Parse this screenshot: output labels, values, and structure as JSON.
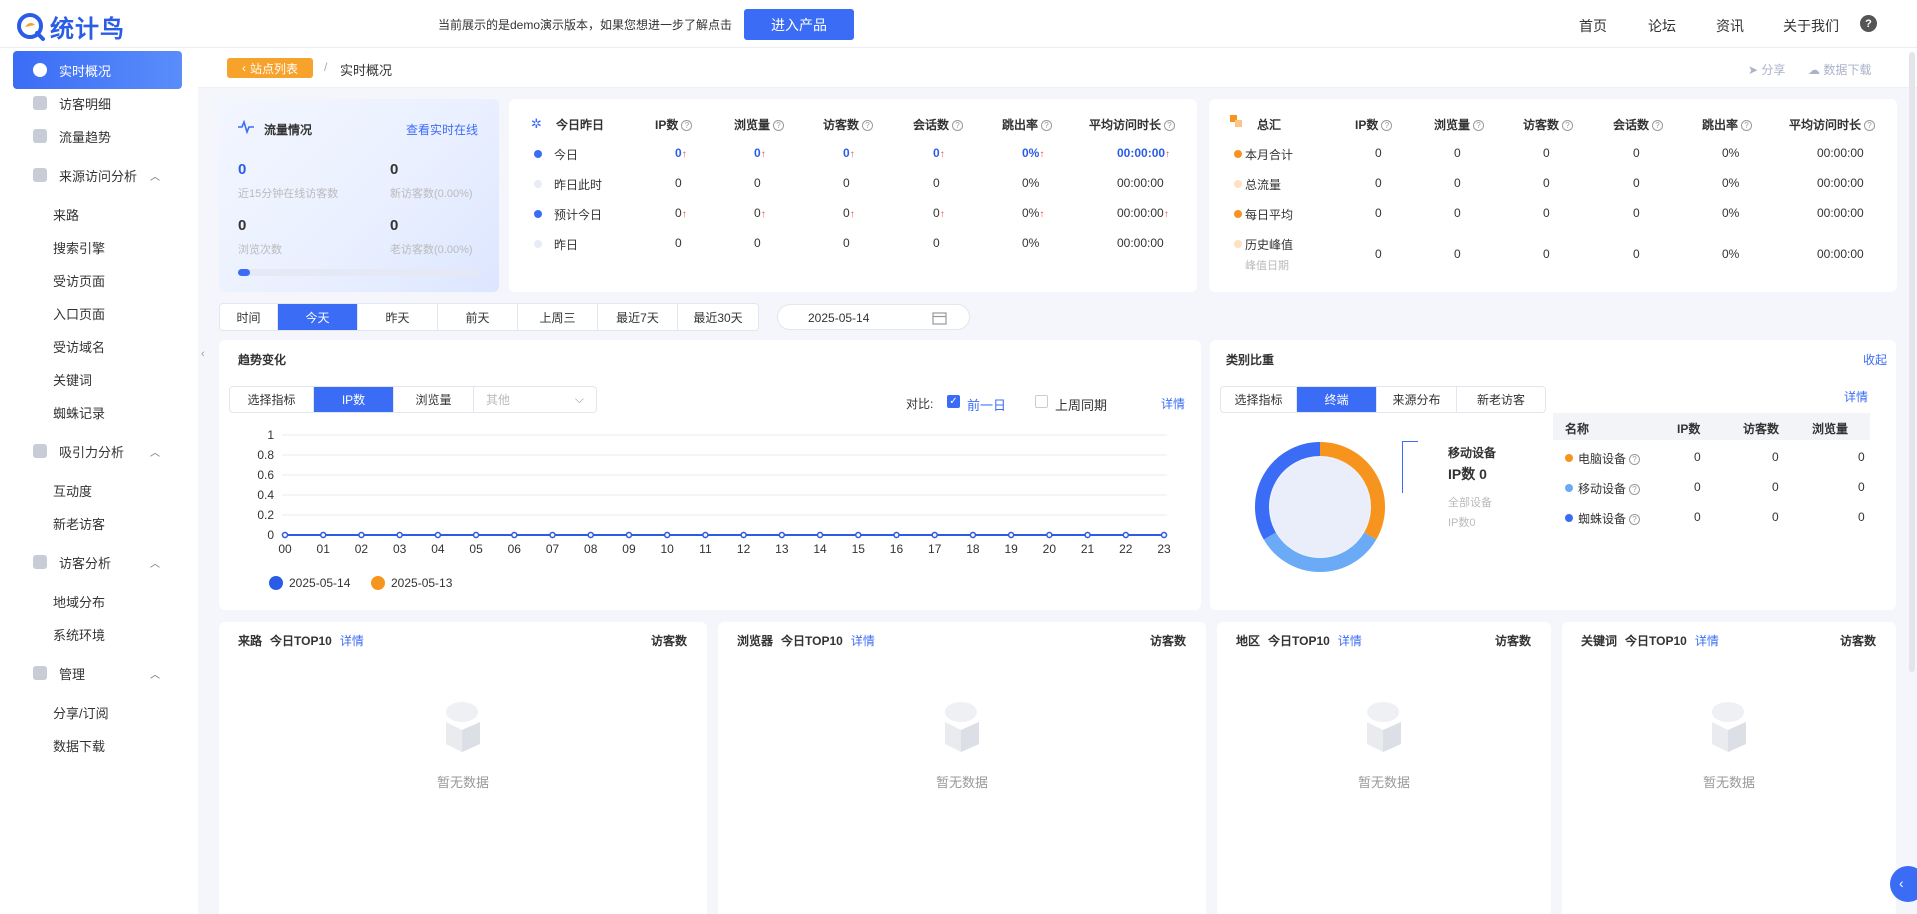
{
  "header": {
    "logo_text": "统计鸟",
    "demo_note": "当前展示的是demo演示版本，如果您想进一步了解点击",
    "enter_button": "进入产品",
    "nav": [
      "首页",
      "论坛",
      "资讯",
      "关于我们"
    ],
    "help": "?"
  },
  "sidebar": {
    "items": [
      {
        "label": "实时概况",
        "type": "top",
        "icon": "clock-icon"
      },
      {
        "label": "访客明细",
        "type": "top",
        "icon": "visitor-detail-icon"
      },
      {
        "label": "流量趋势",
        "type": "top",
        "icon": "trend-icon"
      },
      {
        "label": "来源访问分析",
        "type": "group",
        "icon": "grid-icon"
      },
      {
        "label": "来路",
        "type": "sub"
      },
      {
        "label": "搜索引擎",
        "type": "sub"
      },
      {
        "label": "受访页面",
        "type": "sub"
      },
      {
        "label": "入口页面",
        "type": "sub"
      },
      {
        "label": "受访域名",
        "type": "sub"
      },
      {
        "label": "关键词",
        "type": "sub"
      },
      {
        "label": "蜘蛛记录",
        "type": "sub"
      },
      {
        "label": "吸引力分析",
        "type": "group",
        "icon": "attract-icon"
      },
      {
        "label": "互动度",
        "type": "sub"
      },
      {
        "label": "新老访客",
        "type": "sub"
      },
      {
        "label": "访客分析",
        "type": "group",
        "icon": "user-icon"
      },
      {
        "label": "地域分布",
        "type": "sub"
      },
      {
        "label": "系统环境",
        "type": "sub"
      },
      {
        "label": "管理",
        "type": "group",
        "icon": "manage-icon"
      },
      {
        "label": "分享/订阅",
        "type": "sub"
      },
      {
        "label": "数据下载",
        "type": "sub"
      }
    ]
  },
  "breadcrumb": {
    "back": "站点列表",
    "sep": "/",
    "current": "实时概况",
    "share": "分享",
    "download": "数据下载"
  },
  "flow": {
    "title": "流量情况",
    "link": "查看实时在线",
    "stats": [
      {
        "value": "0",
        "label": "近15分钟在线访客数"
      },
      {
        "value": "0",
        "label": "新访客数(0.00%)"
      },
      {
        "value": "0",
        "label": "浏览次数"
      },
      {
        "value": "0",
        "label": "老访客数(0.00%)"
      }
    ]
  },
  "today": {
    "title": "今日昨日",
    "columns": [
      "IP数",
      "浏览量",
      "访客数",
      "会话数",
      "跳出率",
      "平均访问时长"
    ],
    "rows": [
      {
        "label": "今日",
        "values": [
          "0",
          "0",
          "0",
          "0",
          "0%",
          "00:00:00"
        ],
        "trend": true,
        "dot": "#3b6cf6"
      },
      {
        "label": "昨日此时",
        "values": [
          "0",
          "0",
          "0",
          "0",
          "0%",
          "00:00:00"
        ],
        "trend": false,
        "dot": "#e8ecf7"
      },
      {
        "label": "预计今日",
        "values": [
          "0",
          "0",
          "0",
          "0",
          "0%",
          "00:00:00"
        ],
        "trend": true,
        "dot": "#3b6cf6"
      },
      {
        "label": "昨日",
        "values": [
          "0",
          "0",
          "0",
          "0",
          "0%",
          "00:00:00"
        ],
        "trend": false,
        "dot": "#e8ecf7"
      }
    ]
  },
  "summary": {
    "title": "总汇",
    "columns": [
      "IP数",
      "浏览量",
      "访客数",
      "会话数",
      "跳出率",
      "平均访问时长"
    ],
    "rows": [
      {
        "label": "本月合计",
        "sub": "",
        "values": [
          "0",
          "0",
          "0",
          "0",
          "0%",
          "00:00:00"
        ],
        "dot": "#f7941d"
      },
      {
        "label": "总流量",
        "sub": "",
        "values": [
          "0",
          "0",
          "0",
          "0",
          "0%",
          "00:00:00"
        ],
        "dot": "#fde2c2"
      },
      {
        "label": "每日平均",
        "sub": "",
        "values": [
          "0",
          "0",
          "0",
          "0",
          "0%",
          "00:00:00"
        ],
        "dot": "#f7941d"
      },
      {
        "label": "历史峰值",
        "sub": "峰值日期",
        "values": [
          "0",
          "0",
          "0",
          "0",
          "0%",
          "00:00:00"
        ],
        "dot": "#fde2c2"
      }
    ]
  },
  "timebar": {
    "label": "时间",
    "tabs": [
      "今天",
      "昨天",
      "前天",
      "上周三",
      "最近7天",
      "最近30天"
    ],
    "active": 0,
    "date": "2025-05-14"
  },
  "trend": {
    "title": "趋势变化",
    "select_label": "选择指标",
    "metrics": [
      "IP数",
      "浏览量"
    ],
    "other_placeholder": "其他",
    "compare_label": "对比:",
    "compare_options": [
      {
        "label": "前一日",
        "checked": true
      },
      {
        "label": "上周同期",
        "checked": false
      }
    ],
    "detail": "详情"
  },
  "chart_data": {
    "type": "line",
    "x": [
      "00",
      "01",
      "02",
      "03",
      "04",
      "05",
      "06",
      "07",
      "08",
      "09",
      "10",
      "11",
      "12",
      "13",
      "14",
      "15",
      "16",
      "17",
      "18",
      "19",
      "20",
      "21",
      "22",
      "23"
    ],
    "y_ticks": [
      "0",
      "0.2",
      "0.4",
      "0.6",
      "0.8",
      "1"
    ],
    "ylim": [
      0,
      1
    ],
    "series": [
      {
        "name": "2025-05-14",
        "color": "#2b5ce6",
        "values": [
          0,
          0,
          0,
          0,
          0,
          0,
          0,
          0,
          0,
          0,
          0,
          0,
          0,
          0,
          0,
          0,
          0,
          0,
          0,
          0,
          0,
          0,
          0,
          0
        ]
      },
      {
        "name": "2025-05-13",
        "color": "#f7941d",
        "values": [
          0,
          0,
          0,
          0,
          0,
          0,
          0,
          0,
          0,
          0,
          0,
          0,
          0,
          0,
          0,
          0,
          0,
          0,
          0,
          0,
          0,
          0,
          0,
          0
        ]
      }
    ]
  },
  "ratio": {
    "title": "类别比重",
    "collapse": "收起",
    "select_label": "选择指标",
    "tabs": [
      "终端",
      "来源分布",
      "新老访客"
    ],
    "detail": "详情",
    "donut_label": "移动设备",
    "donut_value": "IP数 0",
    "donut_sub1": "全部设备",
    "donut_sub2": "IP数0",
    "table_columns": [
      "名称",
      "IP数",
      "访客数",
      "浏览量"
    ],
    "rows": [
      {
        "name": "电脑设备",
        "color": "#f7941d",
        "values": [
          "0",
          "0",
          "0"
        ]
      },
      {
        "name": "移动设备",
        "color": "#6aaaf6",
        "values": [
          "0",
          "0",
          "0"
        ]
      },
      {
        "name": "蜘蛛设备",
        "color": "#3b6cf6",
        "values": [
          "0",
          "0",
          "0"
        ]
      }
    ]
  },
  "bottom_cards": [
    {
      "name": "来路",
      "title": "今日TOP10",
      "link": "详情",
      "right": "访客数",
      "empty": "暂无数据"
    },
    {
      "name": "浏览器",
      "title": "今日TOP10",
      "link": "详情",
      "right": "访客数",
      "empty": "暂无数据"
    },
    {
      "name": "地区",
      "title": "今日TOP10",
      "link": "详情",
      "right": "访客数",
      "empty": "暂无数据"
    },
    {
      "name": "关键词",
      "title": "今日TOP10",
      "link": "详情",
      "right": "访客数",
      "empty": "暂无数据"
    }
  ],
  "colors": {
    "accent": "#3b6cf6",
    "orange": "#f7941d",
    "back_button": "#f7a22b"
  }
}
